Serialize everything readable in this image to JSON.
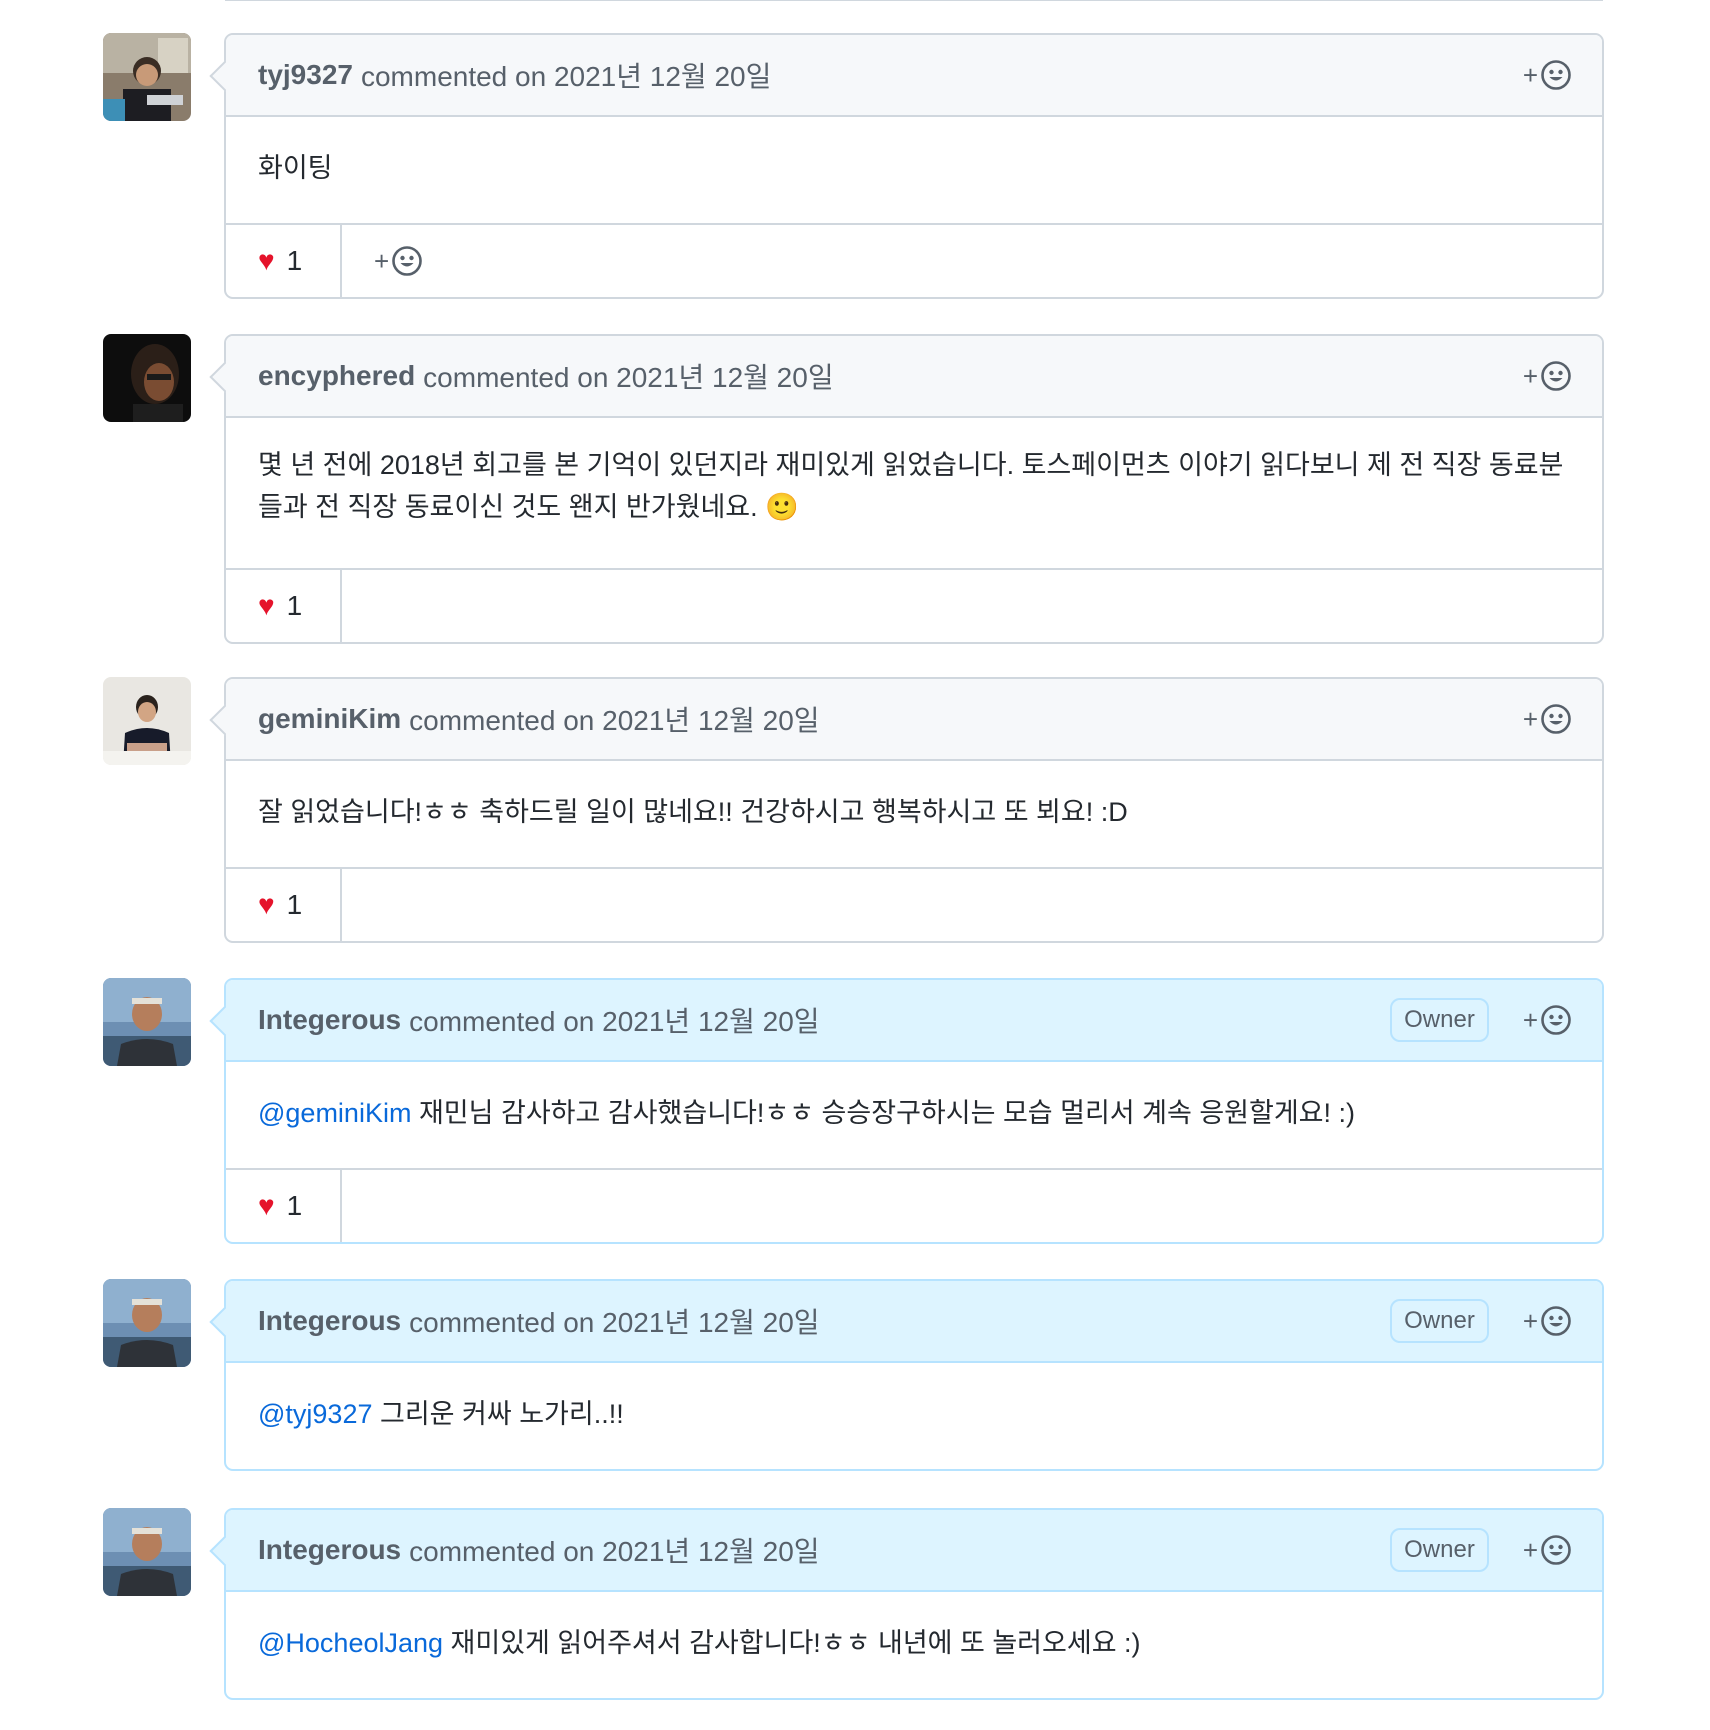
{
  "comments": [
    {
      "author": "tyj9327",
      "meta": "commented on 2021년 12월 20일",
      "owner": false,
      "body_mention": "",
      "body_text": "화이팅",
      "reaction": {
        "emoji": "❤️",
        "count": "1"
      },
      "show_footer_add": true
    },
    {
      "author": "encyphered",
      "meta": "commented on 2021년 12월 20일",
      "owner": false,
      "body_mention": "",
      "body_text": "몇 년 전에 2018년 회고를 본 기억이 있던지라 재미있게 읽었습니다. 토스페이먼츠 이야기 읽다보니 제 전 직장 동료분들과 전 직장 동료이신 것도 왠지 반가웠네요. 🙂",
      "reaction": {
        "emoji": "❤️",
        "count": "1"
      },
      "show_footer_add": false
    },
    {
      "author": "geminiKim",
      "meta": "commented on 2021년 12월 20일",
      "owner": false,
      "body_mention": "",
      "body_text": "잘 읽었습니다!ㅎㅎ 축하드릴 일이 많네요!! 건강하시고 행복하시고 또 뵈요! :D",
      "reaction": {
        "emoji": "❤️",
        "count": "1"
      },
      "show_footer_add": false
    },
    {
      "author": "Integerous",
      "meta": "commented on 2021년 12월 20일",
      "owner": true,
      "owner_label": "Owner",
      "body_mention": "@geminiKim",
      "body_text": " 재민님 감사하고 감사했습니다!ㅎㅎ 승승장구하시는 모습 멀리서 계속 응원할게요! :)",
      "reaction": {
        "emoji": "❤️",
        "count": "1"
      },
      "show_footer_add": false
    },
    {
      "author": "Integerous",
      "meta": "commented on 2021년 12월 20일",
      "owner": true,
      "owner_label": "Owner",
      "body_mention": "@tyj9327",
      "body_text": " 그리운 커싸 노가리..!!",
      "reaction": null,
      "show_footer_add": false
    },
    {
      "author": "Integerous",
      "meta": "commented on 2021년 12월 20일",
      "owner": true,
      "owner_label": "Owner",
      "body_mention": "@HocheolJang",
      "body_text": " 재미있게 읽어주셔서 감사합니다!ㅎㅎ 내년에 또 놀러오세요 :)",
      "reaction": null,
      "show_footer_add": false
    }
  ],
  "icons": {
    "add_reaction": "smiley-icon",
    "plus": "+"
  },
  "colors": {
    "mention": "#0969da",
    "owner_header": "#ddf4ff",
    "header": "#f6f8fa",
    "border": "#d0d7de",
    "heart": "#e5132b"
  }
}
